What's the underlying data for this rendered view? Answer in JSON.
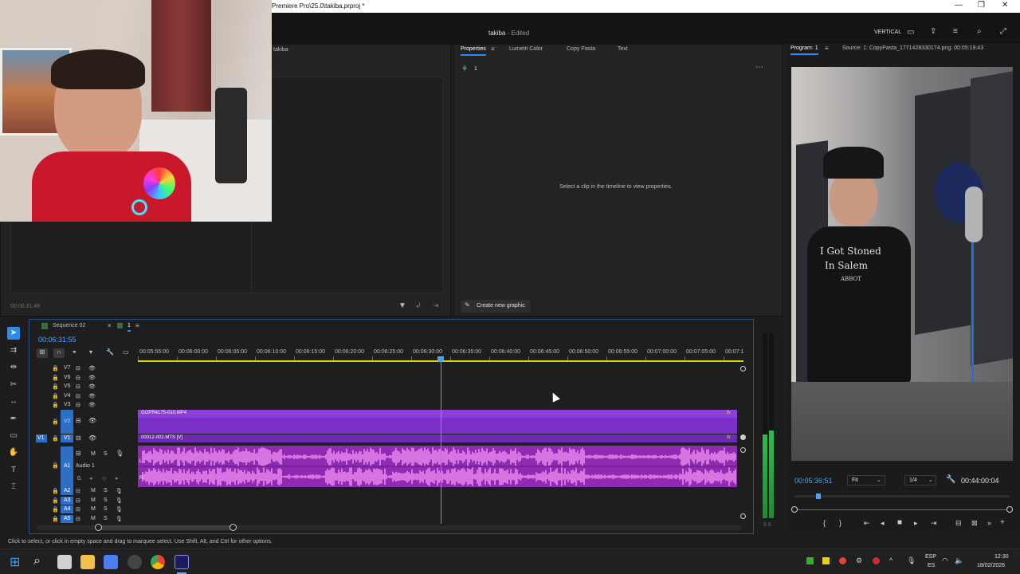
{
  "window": {
    "title": "Premiere Pro\\25.0\\takiba.prproj *",
    "minimize": "—",
    "restore": "❐",
    "close": "✕"
  },
  "header": {
    "project_name": "takiba",
    "project_status": "- Edited",
    "mode_label": "VERTICAL"
  },
  "project_panel": {
    "tab_label": "takiba",
    "timecode": "00:06:31:49"
  },
  "properties_panel": {
    "tabs": [
      "Properties",
      "Lumetri Color",
      "Copy Pasta",
      "Text"
    ],
    "item_label": "1",
    "empty_message": "Select a clip in the timeline to view properties.",
    "create_graphic_label": "Create new graphic"
  },
  "program_monitor": {
    "tab_label": "Program: 1",
    "source_label": "Source: 1: CopyPasta_1771428330174.png: 00:05:19:43",
    "current_timecode": "00:05:36:51",
    "zoom_value": "Fit",
    "resolution_value": "1/4",
    "duration_timecode": "00:44:00:04",
    "shirt_text_1": "I Got Stoned",
    "shirt_text_2": "In Salem",
    "shirt_text_3": "ABBOT"
  },
  "timeline": {
    "tab_sequence": "Sequence 02",
    "tab_1": "1",
    "playhead_timecode": "00:06:31:55",
    "ruler_ticks": [
      "00:05:55:00",
      "00:06:00:00",
      "00:06:05:00",
      "00:06:10:00",
      "00:06:15:00",
      "00:06:20:00",
      "00:06:25:00",
      "00:06:30:00",
      "00:06:35:00",
      "00:06:40:00",
      "00:06:45:00",
      "00:06:50:00",
      "00:06:55:00",
      "00:07:00:00",
      "00:07:05:00",
      "00:07:1"
    ],
    "video_tracks_upper": [
      "V7",
      "V6",
      "V5",
      "V4",
      "V3"
    ],
    "track_v2": "V2",
    "track_v1": "V1",
    "source_v1": "V1",
    "track_a1": "A1",
    "a1_name": "Audio 1",
    "audio_tracks_lower": [
      "A2",
      "A3",
      "A4",
      "A5"
    ],
    "mute_label": "M",
    "solo_label": "S",
    "volume_label": "0.",
    "clip_v2": "GOPR4175-010.MP4",
    "clip_v1": "00012-002.MTS [V]",
    "fx_label": "fx",
    "left_channel": "L",
    "right_channel": "R",
    "meter_labels": "S S"
  },
  "status_bar": {
    "message": "Click to select, or click in empty space and drag to marquee select. Use Shift, Alt, and Ctrl for other options."
  },
  "taskbar": {
    "language_top": "ESP",
    "language_bottom": "ES",
    "time": "12:30",
    "date": "18/02/2026"
  },
  "colors": {
    "accent": "#2d8ceb",
    "video_clip": "#7a2fc7",
    "audio_clip": "#8e2bb2",
    "playhead": "#4aa3ff",
    "work_area": "#d7d400",
    "meter_green": "#2fbf4a"
  }
}
